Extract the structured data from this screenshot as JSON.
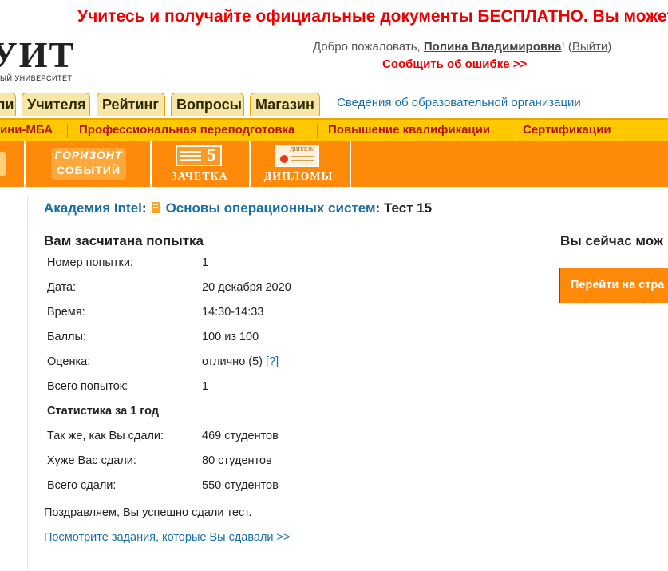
{
  "promo": {
    "text": "Учитесь и получайте официальные документы БЕСПЛАТНО. Вы можете п"
  },
  "logo": {
    "text": "УИТ",
    "subtitle": "ЫЙ УНИВЕРСИТЕТ"
  },
  "header": {
    "welcome_prefix": "Добро пожаловать, ",
    "user_name": "Полина Владимировна",
    "suffix": "! (",
    "logout": "Выйти",
    "close_paren": ")",
    "report_error": "Сообщить об ошибке >>"
  },
  "tabs": [
    {
      "label": "ли"
    },
    {
      "label": "Учителя"
    },
    {
      "label": "Рейтинг"
    },
    {
      "label": "Вопросы"
    },
    {
      "label": "Магазин"
    }
  ],
  "org_info_link": "Сведения об образовательной организации",
  "yellow_menu": [
    {
      "label": "ини-МБА"
    },
    {
      "label": "Профессиональная переподготовка"
    },
    {
      "label": "Повышение квалификации"
    },
    {
      "label": "Сертификации"
    }
  ],
  "banners": {
    "horizon_line1": "ГОРИЗОНТ",
    "horizon_line2": "СОБЫТИЙ",
    "zachetka_number": "5",
    "zachetka_label": "ЗАЧЕТКА",
    "diploma_small": "ДИПЛОМ",
    "diploma_label": "ДИПЛОМЫ"
  },
  "breadcrumb": {
    "academy": "Академия Intel",
    "colon1": ":",
    "course": "Основы операционных систем",
    "colon2": ":",
    "test": " Тест 15"
  },
  "result": {
    "title": "Вам засчитана попытка",
    "rows": [
      {
        "label": "Номер попытки:",
        "value": "1"
      },
      {
        "label": "Дата:",
        "value": "20 декабря 2020"
      },
      {
        "label": "Время:",
        "value": "14:30-14:33"
      },
      {
        "label": "Баллы:",
        "value": "100 из 100"
      },
      {
        "label": "Оценка:",
        "value": "отлично (5)",
        "help": "[?]"
      },
      {
        "label": "Всего попыток:",
        "value": "1"
      }
    ],
    "stats_title": "Статистика за 1 год",
    "stats": [
      {
        "label": "Так же, как Вы сдали:",
        "value": "469 студентов"
      },
      {
        "label": "Хуже Вас сдали:",
        "value": "80 студентов"
      },
      {
        "label": "Всего сдали:",
        "value": "550 студентов"
      }
    ],
    "congrats": "Поздравляем, Вы успешно сдали тест.",
    "tasks_link": "Посмотрите задания, которые Вы сдавали >>"
  },
  "right_panel": {
    "title": "Вы сейчас мож",
    "button": "Перейти на стра"
  },
  "colors": {
    "accent_orange": "#ff8a0a",
    "menu_yellow": "#ffc800",
    "link_blue": "#1a6ea8",
    "promo_red": "#ee0000"
  }
}
